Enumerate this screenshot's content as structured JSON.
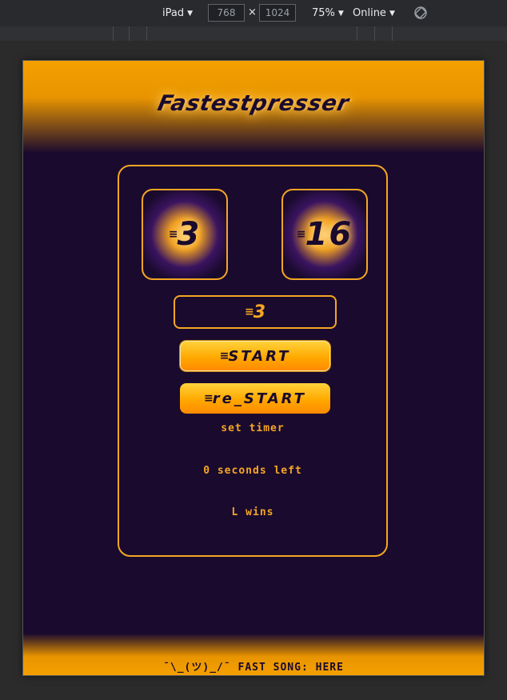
{
  "devtools": {
    "device": "iPad",
    "width": "768",
    "height": "1024",
    "times": "×",
    "zoom": "75%",
    "network": "Online",
    "caret": "▼"
  },
  "game": {
    "title": "Fastestpresser",
    "score_left": "3",
    "score_right": "16",
    "timer_value": "3",
    "start_label": "START",
    "restart_label": "re_START",
    "set_timer_label": "set timer",
    "seconds_left_label": "0 seconds left",
    "result_label": "L wins",
    "footer": "¯\\_(ツ)_/¯ FAST SONG: HERE"
  },
  "colors": {
    "accent": "#f5a623",
    "background": "#1a0a2e"
  }
}
